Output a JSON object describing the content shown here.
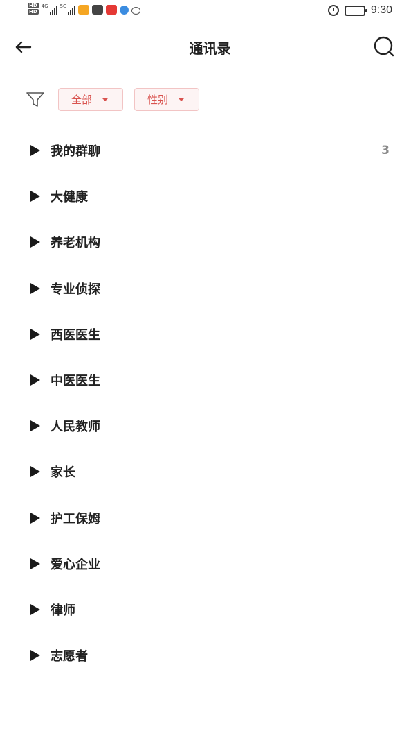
{
  "status_bar": {
    "net1": "4G",
    "net2": "5G",
    "hd1": "HD",
    "hd2": "HD",
    "time": "9:30",
    "battery_level": 0.75
  },
  "header": {
    "title": "通讯录"
  },
  "filters": {
    "all_label": "全部",
    "gender_label": "性别"
  },
  "groups": [
    {
      "label": "我的群聊",
      "count": "3"
    },
    {
      "label": "大健康",
      "count": ""
    },
    {
      "label": "养老机构",
      "count": ""
    },
    {
      "label": "专业侦探",
      "count": ""
    },
    {
      "label": "西医医生",
      "count": ""
    },
    {
      "label": "中医医生",
      "count": ""
    },
    {
      "label": "人民教师",
      "count": ""
    },
    {
      "label": "家长",
      "count": ""
    },
    {
      "label": "护工保姆",
      "count": ""
    },
    {
      "label": "爱心企业",
      "count": ""
    },
    {
      "label": "律师",
      "count": ""
    },
    {
      "label": "志愿者",
      "count": ""
    }
  ],
  "colors": {
    "accent": "#d9534f",
    "chip_bg": "#fdf4f4",
    "chip_border": "#f2c4c4"
  }
}
